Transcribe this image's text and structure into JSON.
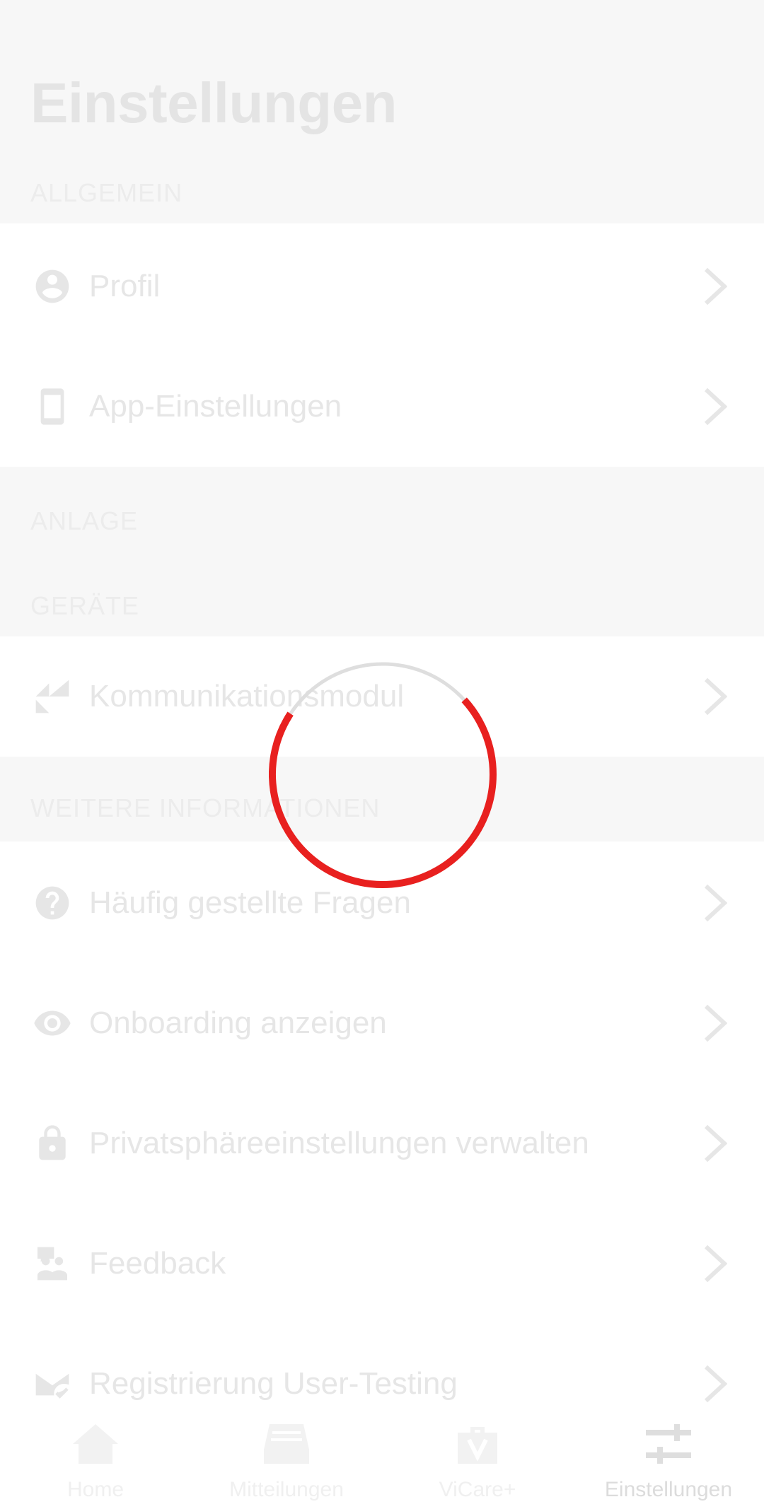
{
  "header": {
    "title": "Einstellungen"
  },
  "sections": {
    "allgemein": "ALLGEMEIN",
    "anlage": "ANLAGE",
    "geraete": "GERÄTE",
    "weitere": "WEITERE INFORMATIONEN"
  },
  "items": {
    "profil": {
      "label": "Profil",
      "icon": "account-circle-icon"
    },
    "app_settings": {
      "label": "App-Einstellungen",
      "icon": "smartphone-icon"
    },
    "kommunikation": {
      "label": "Kommunikationsmodul",
      "icon": "communication-module-icon"
    },
    "faq": {
      "label": "Häufig gestellte Fragen",
      "icon": "help-circle-icon"
    },
    "onboarding": {
      "label": "Onboarding anzeigen",
      "icon": "eye-icon"
    },
    "privacy": {
      "label": "Privatsphäreeinstellungen verwalten",
      "icon": "lock-icon"
    },
    "feedback": {
      "label": "Feedback",
      "icon": "feedback-icon"
    },
    "user_testing": {
      "label": "Registrierung User-Testing",
      "icon": "mail-check-icon"
    }
  },
  "navbar": {
    "home": "Home",
    "mitteilungen": "Mitteilungen",
    "vicare": "ViCare+",
    "einstellungen": "Einstellungen"
  },
  "colors": {
    "spinner_accent": "#e8201f",
    "spinner_track": "#dedede",
    "faded_text": "#e6e6e6"
  }
}
